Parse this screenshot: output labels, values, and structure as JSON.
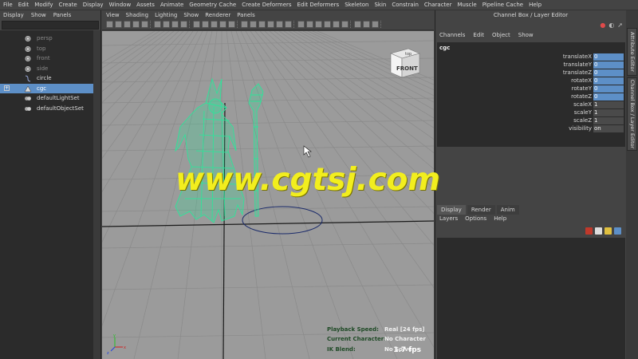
{
  "menubar": [
    "File",
    "Edit",
    "Modify",
    "Create",
    "Display",
    "Window",
    "Assets",
    "Animate",
    "Geometry Cache",
    "Create Deformers",
    "Edit Deformers",
    "Skeleton",
    "Skin",
    "Constrain",
    "Character",
    "Muscle",
    "Pipeline Cache",
    "Help"
  ],
  "outliner": {
    "menu": [
      "Display",
      "Show",
      "Panels"
    ],
    "items": [
      {
        "label": "persp",
        "icon": "camera-icon",
        "dim": true
      },
      {
        "label": "top",
        "icon": "camera-icon",
        "dim": true
      },
      {
        "label": "front",
        "icon": "camera-icon",
        "dim": true
      },
      {
        "label": "side",
        "icon": "camera-icon",
        "dim": true
      },
      {
        "label": "circle",
        "icon": "curve-icon",
        "dim": false
      },
      {
        "label": "cgc",
        "icon": "mesh-icon",
        "dim": false,
        "selected": true
      },
      {
        "label": "defaultLightSet",
        "icon": "set-icon",
        "dim": false
      },
      {
        "label": "defaultObjectSet",
        "icon": "set-icon",
        "dim": false
      }
    ]
  },
  "viewport": {
    "menu": [
      "View",
      "Shading",
      "Lighting",
      "Show",
      "Renderer",
      "Panels"
    ],
    "viewcube_label": "FRONT",
    "viewcube_top": "top",
    "hud": [
      {
        "label": "Playback Speed:",
        "value": "Real [24 fps]"
      },
      {
        "label": "Current Character:",
        "value": "No Character"
      },
      {
        "label": "IK Blend:",
        "value": "No Solver"
      }
    ],
    "fps": "1.7 fps",
    "axis": {
      "x": "x",
      "y": "y",
      "z": "z"
    }
  },
  "channel_box": {
    "title": "Channel Box / Layer Editor",
    "menu": [
      "Channels",
      "Edit",
      "Object",
      "Show"
    ],
    "object": "cgc",
    "channels": [
      {
        "name": "translateX",
        "value": "0",
        "keyed": true
      },
      {
        "name": "translateY",
        "value": "0",
        "keyed": true
      },
      {
        "name": "translateZ",
        "value": "0",
        "keyed": true
      },
      {
        "name": "rotateX",
        "value": "0",
        "keyed": true
      },
      {
        "name": "rotateY",
        "value": "0",
        "keyed": true
      },
      {
        "name": "rotateZ",
        "value": "0",
        "keyed": true
      },
      {
        "name": "scaleX",
        "value": "1",
        "keyed": false
      },
      {
        "name": "scaleY",
        "value": "1",
        "keyed": false
      },
      {
        "name": "scaleZ",
        "value": "1",
        "keyed": false
      },
      {
        "name": "visibility",
        "value": "on",
        "keyed": false
      }
    ]
  },
  "layer_editor": {
    "tabs": [
      "Display",
      "Render",
      "Anim"
    ],
    "active_tab": "Display",
    "menu": [
      "Layers",
      "Options",
      "Help"
    ]
  },
  "side_tabs": [
    "Attribute Editor",
    "Channel Box / Layer Editor"
  ],
  "watermark": "www.cgtsj.com",
  "colors": {
    "wireframe": "#2fe39a",
    "selection": "#5d8fc7",
    "watermark": "#f2ee1e",
    "grid_bg": "#9b9b9b"
  }
}
